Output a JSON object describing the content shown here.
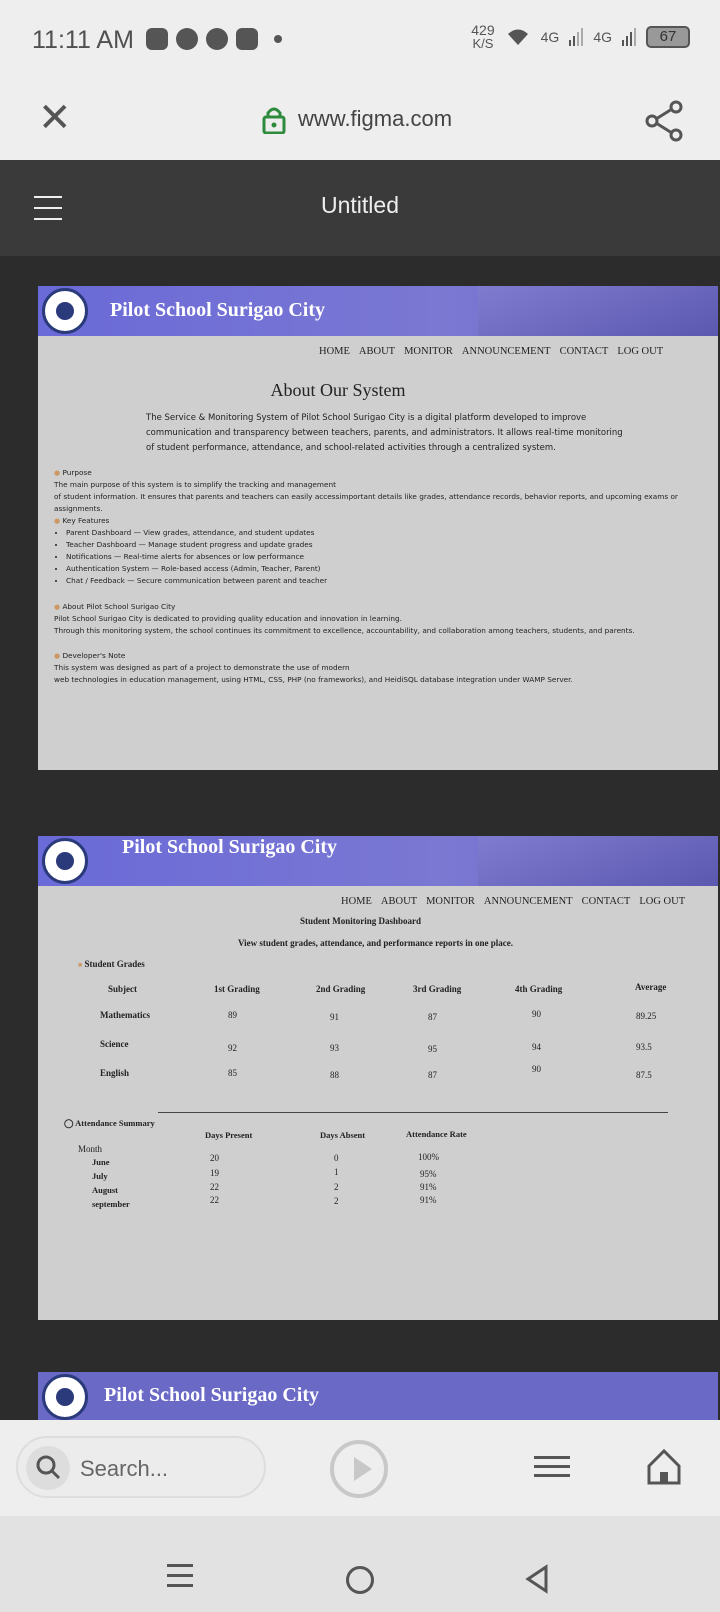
{
  "status": {
    "time": "11:11 AM",
    "net_speed": "429",
    "net_unit": "K/S",
    "sig1": "4G",
    "sig2": "4G",
    "battery": "67"
  },
  "browser": {
    "url": "www.figma.com"
  },
  "figma": {
    "title": "Untitled"
  },
  "school": {
    "name": "Pilot School Surigao City"
  },
  "nav": [
    "HOME",
    "ABOUT",
    "MONITOR",
    "ANNOUNCEMENT",
    "CONTACT",
    "LOG OUT"
  ],
  "about": {
    "title": "About Our System",
    "intro": [
      "The Service & Monitoring System of Pilot School Surigao City is a digital platform developed to improve",
      "communication and transparency between teachers, parents, and administrators. It allows real-time monitoring",
      "of student performance, attendance, and school-related activities through a centralized system."
    ],
    "purpose_title": "Purpose",
    "purpose": [
      "The main purpose of this system is to simplify the tracking and management",
      "of student information. It ensures that parents and teachers can easily accessimportant details like grades, attendance records, behavior reports, and upcoming exams or assignments."
    ],
    "features_title": "Key Features",
    "features": [
      "Parent Dashboard — View grades, attendance, and student updates",
      "Teacher Dashboard — Manage student progress and update grades",
      "Notifications — Real-time alerts for absences or low performance",
      "Authentication System — Role-based access (Admin, Teacher, Parent)",
      "Chat / Feedback — Secure communication between parent and teacher"
    ],
    "school_title": "About Pilot School Surigao City",
    "school_text": [
      "Pilot School Surigao City is dedicated to providing quality education and innovation in learning.",
      "Through this monitoring system, the school continues its commitment to excellence, accountability, and collaboration among teachers, students, and parents."
    ],
    "dev_title": "Developer's Note",
    "dev_text": [
      "This system was designed as part of a project to demonstrate the use of modern",
      "web technologies in education management, using HTML, CSS, PHP (no frameworks), and HeidiSQL database integration under WAMP Server."
    ]
  },
  "monitor": {
    "title": "Student Monitoring Dashboard",
    "subtitle": "View student grades, attendance, and performance reports in one place.",
    "grades_title": "Student Grades",
    "grade_headers": [
      "Subject",
      "1st Grading",
      "2nd Grading",
      "3rd Grading",
      "4th Grading",
      "Average"
    ],
    "grades": [
      [
        "Mathematics",
        "89",
        "91",
        "87",
        "90",
        "89.25"
      ],
      [
        "Science",
        "92",
        "93",
        "95",
        "94",
        "93.5"
      ],
      [
        "English",
        "85",
        "88",
        "87",
        "90",
        "87.5"
      ]
    ],
    "att_title": "Attendance Summary",
    "att_headers": [
      "Month",
      "Days Present",
      "Days Absent",
      "Attendance Rate"
    ],
    "attendance": [
      [
        "June",
        "20",
        "0",
        "100%"
      ],
      [
        "July",
        "19",
        "1",
        "95%"
      ],
      [
        "August",
        "22",
        "2",
        "91%"
      ],
      [
        "september",
        "22",
        "2",
        "91%"
      ]
    ]
  },
  "bottom": {
    "search_placeholder": "Search..."
  }
}
